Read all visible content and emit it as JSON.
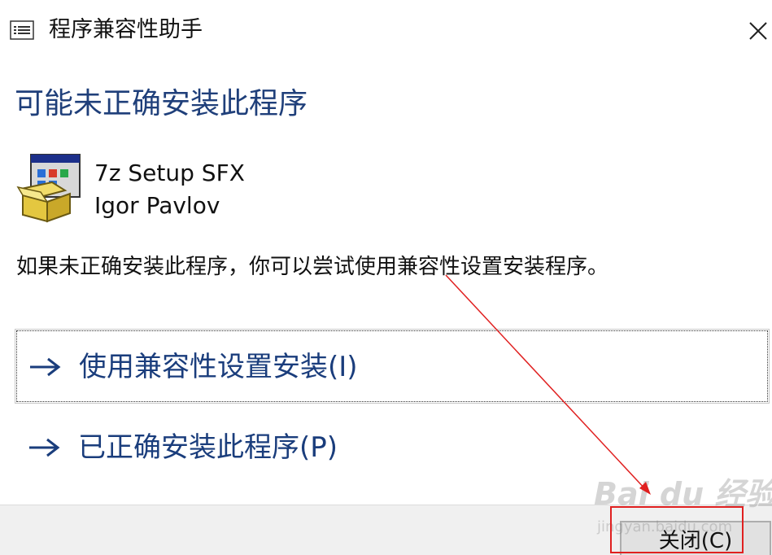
{
  "window": {
    "title": "程序兼容性助手",
    "icons": {
      "title_icon": "list-window-icon",
      "close_icon": "close-icon",
      "program_icon": "installer-package-icon"
    }
  },
  "main": {
    "heading": "可能未正确安装此程序",
    "program": {
      "name": "7z Setup SFX",
      "publisher": "Igor Pavlov"
    },
    "description": "如果未正确安装此程序，你可以尝试使用兼容性设置安装程序。",
    "options": [
      {
        "label": "使用兼容性设置安装(I)",
        "icon": "arrow-right-icon",
        "focused": true
      },
      {
        "label": "已正确安装此程序(P)",
        "icon": "arrow-right-icon",
        "focused": false
      }
    ]
  },
  "footer": {
    "close_button_label": "关闭(C)"
  },
  "watermark": {
    "brand": "Bai du 经验",
    "url": "jingyan.baidu.com"
  },
  "colors": {
    "heading": "#1f3f7a",
    "link": "#1a3d7c",
    "annotation_red": "#e02020",
    "footer_bg": "#f0f0f0"
  }
}
